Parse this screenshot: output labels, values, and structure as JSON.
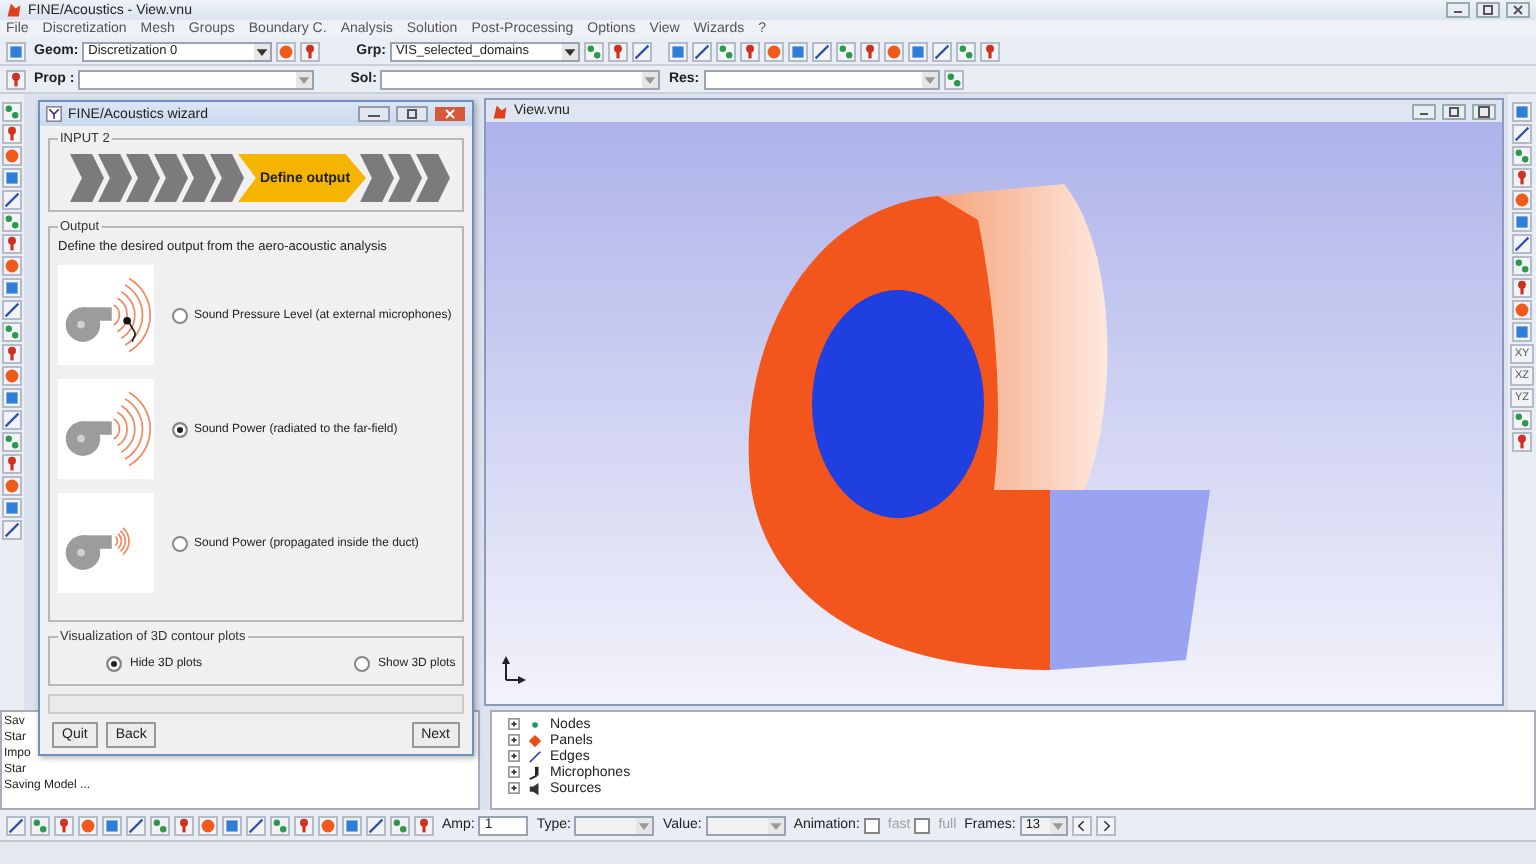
{
  "app_window": {
    "title": "FINE/Acoustics - View.vnu"
  },
  "menu": [
    "File",
    "Discretization",
    "Mesh",
    "Groups",
    "Boundary C.",
    "Analysis",
    "Solution",
    "Post-Processing",
    "Options",
    "View",
    "Wizards",
    "?"
  ],
  "toolbar": {
    "geom": {
      "label": "Geom:",
      "value": "Discretization 0"
    },
    "grp": {
      "label": "Grp:",
      "value": "VIS_selected_domains"
    },
    "prop": {
      "label": "Prop :"
    },
    "sol": {
      "label": "Sol:"
    },
    "res": {
      "label": "Res:"
    }
  },
  "wizard": {
    "title": "FINE/Acoustics wizard",
    "progress": {
      "title": "INPUT 2",
      "steps": [
        {
          "selected": false
        },
        {
          "selected": false
        },
        {
          "selected": false
        },
        {
          "selected": false
        },
        {
          "selected": false
        },
        {
          "selected": false
        },
        {
          "selected": true,
          "label": "Define output"
        },
        {
          "selected": false
        },
        {
          "selected": false
        },
        {
          "selected": false
        }
      ]
    },
    "output": {
      "title": "Output",
      "description": "Define the desired output from the aero-acoustic analysis",
      "options": [
        {
          "label": "Sound Pressure Level (at external microphones)",
          "kind": "microphone",
          "selected": false
        },
        {
          "label": "Sound Power (radiated to the far-field)",
          "kind": "far_field",
          "selected": true
        },
        {
          "label": "Sound Power (propagated inside the duct)",
          "kind": "duct",
          "selected": false
        }
      ]
    },
    "visualization": {
      "title": "Visualization of 3D contour plots",
      "options": [
        {
          "label": "Hide 3D plots",
          "selected": true
        },
        {
          "label": "Show 3D plots",
          "selected": false
        }
      ]
    },
    "buttons": [
      {
        "label": "Quit",
        "kind": "quit"
      },
      {
        "label": "Back",
        "kind": "back"
      },
      {
        "label": "Next",
        "kind": "next"
      }
    ]
  },
  "view": {
    "title": "View.vnu"
  },
  "log": [
    "Sav",
    "Star",
    "Impo",
    "Star",
    "Saving Model ..."
  ],
  "tree": [
    {
      "label": "Nodes",
      "kind": "node",
      "expanded": false
    },
    {
      "label": "Panels",
      "kind": "panel",
      "expanded": false
    },
    {
      "label": "Edges",
      "kind": "edge",
      "expanded": false
    },
    {
      "label": "Microphones",
      "kind": "microphone",
      "expanded": false
    },
    {
      "label": "Sources",
      "kind": "source",
      "expanded": false
    }
  ],
  "animation_bar": {
    "amp": {
      "label": "Amp:",
      "value": "1"
    },
    "type": {
      "label": "Type:"
    },
    "value": {
      "label": "Value:"
    },
    "animation": {
      "label": "Animation:",
      "options": [
        {
          "label": "fast",
          "checked": false,
          "disabled": true
        },
        {
          "label": "full",
          "checked": false,
          "disabled": true
        }
      ]
    },
    "frames": {
      "label": "Frames:",
      "value": "13"
    }
  },
  "axis_buttons": [
    "XY",
    "XZ",
    "YZ"
  ]
}
